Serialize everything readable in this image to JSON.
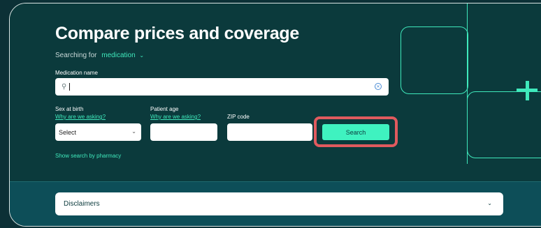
{
  "header": {
    "title": "Compare prices and coverage"
  },
  "searching": {
    "prefix": "Searching for",
    "value": "medication"
  },
  "medication": {
    "label": "Medication name",
    "value": ""
  },
  "sex": {
    "label": "Sex at birth",
    "help_link": "Why are we asking?",
    "selected": "Select"
  },
  "age": {
    "label": "Patient age",
    "help_link": "Why are we asking?",
    "value": ""
  },
  "zip": {
    "label": "ZIP code",
    "value": ""
  },
  "search_button": {
    "label": "Search"
  },
  "pharmacy_link": {
    "label": "Show search by pharmacy"
  },
  "disclaimers": {
    "label": "Disclaimers"
  },
  "colors": {
    "accent": "#3fe9bc",
    "background": "#0b3a3c",
    "highlight": "#e05a5e"
  }
}
